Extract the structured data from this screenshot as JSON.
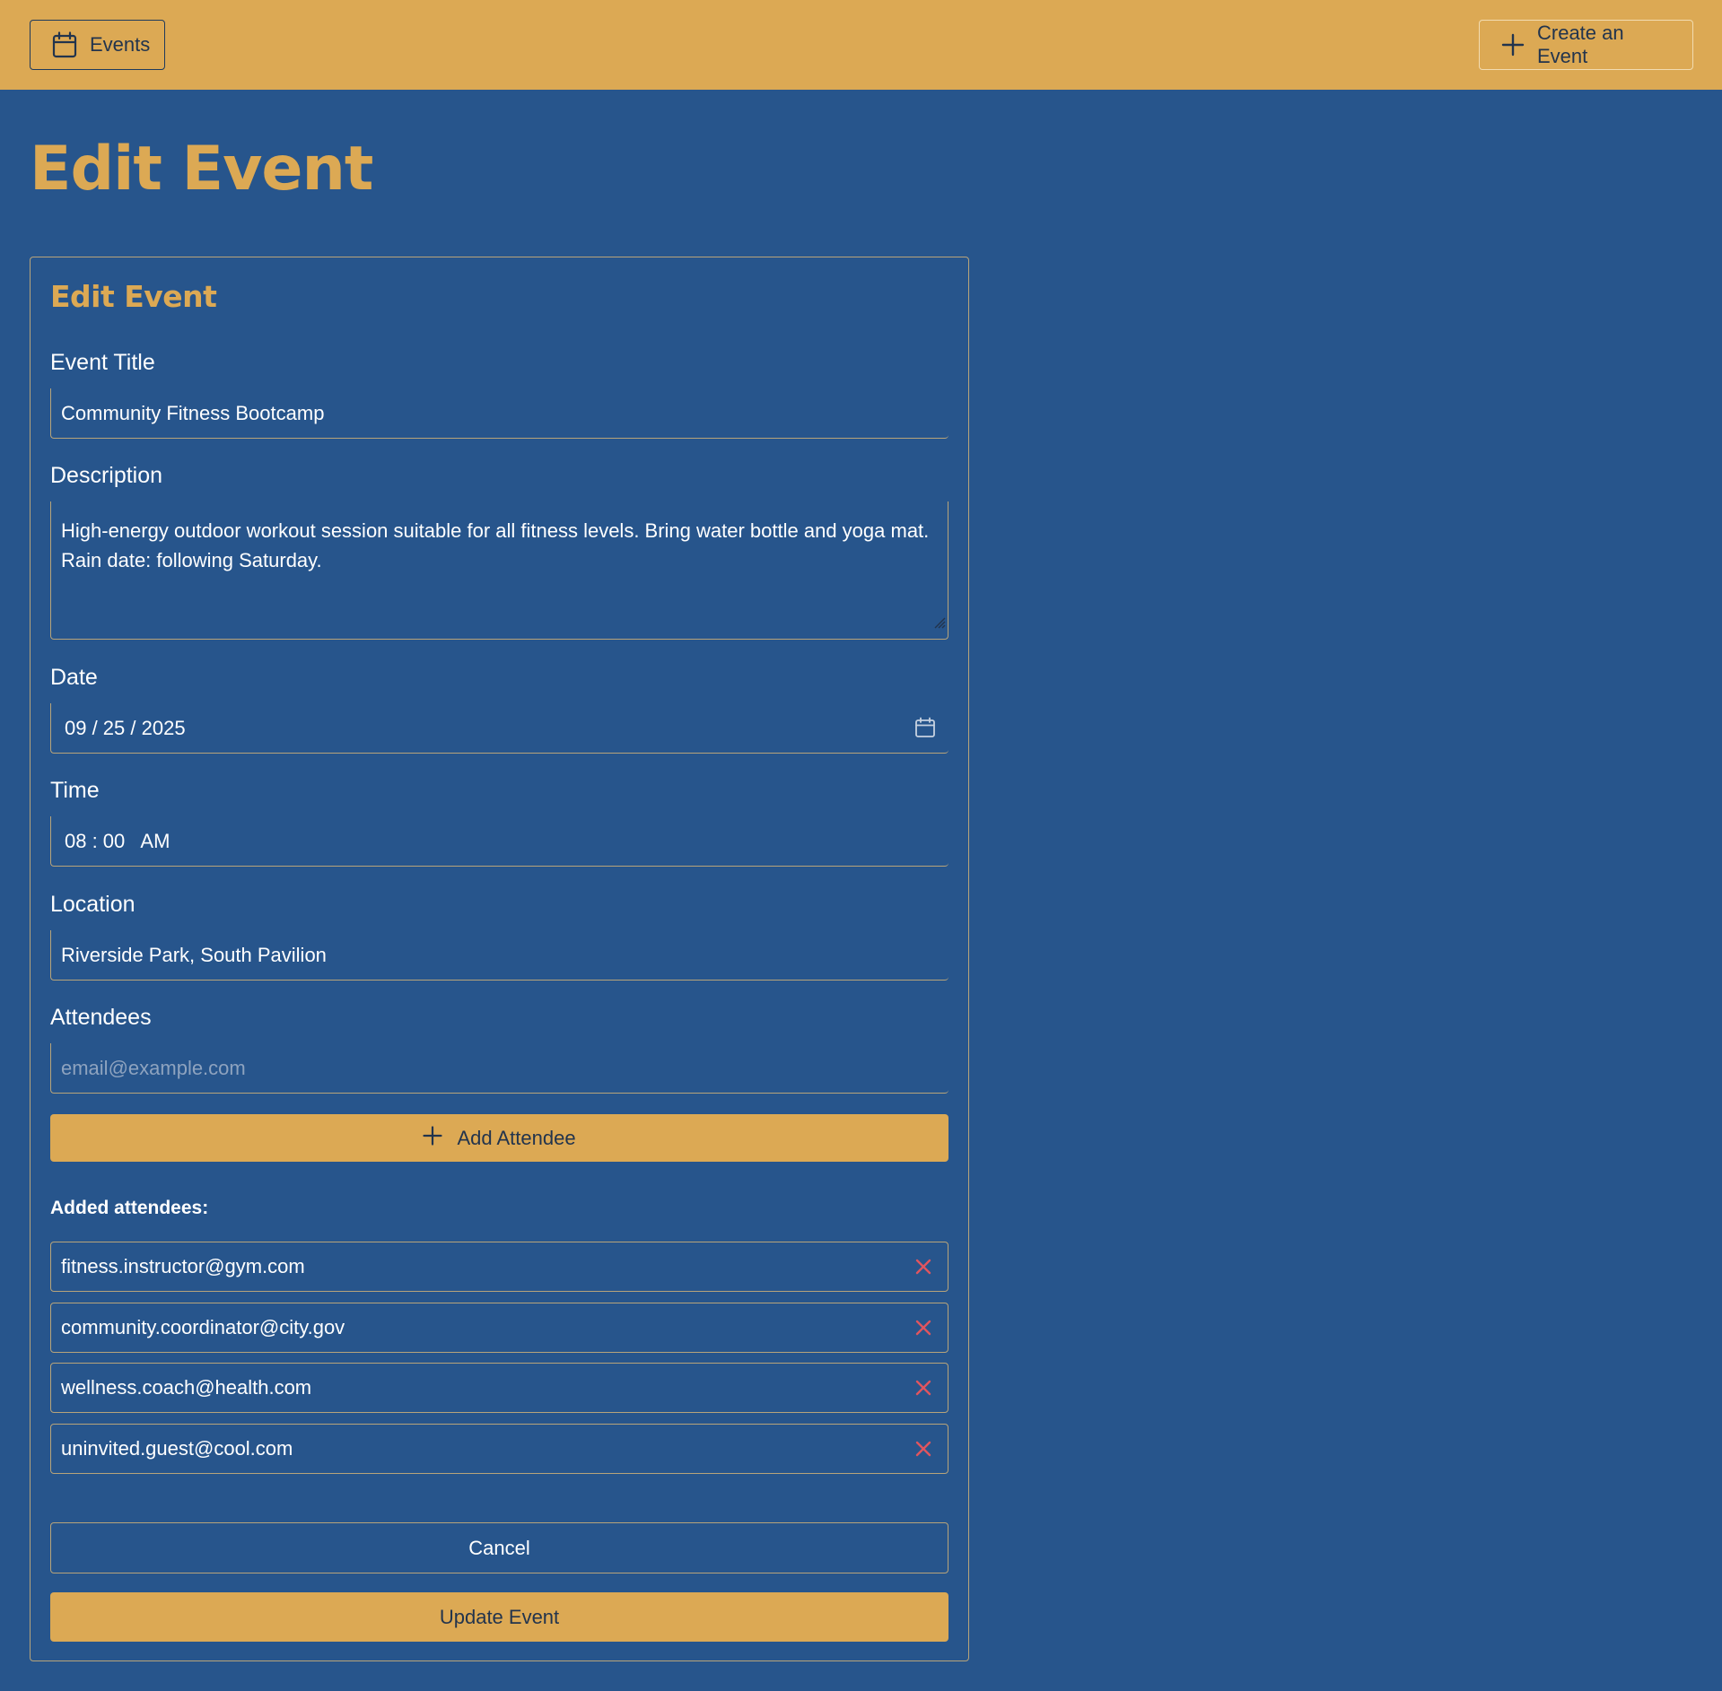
{
  "header": {
    "events_label": "Events",
    "events_icon": "calendar-icon",
    "create_label": "Create an Event",
    "create_icon": "plus-icon"
  },
  "page": {
    "title": "Edit Event"
  },
  "form": {
    "title": "Edit Event",
    "event_title": {
      "label": "Event Title",
      "value": "Community Fitness Bootcamp"
    },
    "description": {
      "label": "Description",
      "value_line1": "High-energy outdoor workout session suitable for all fitness levels. Bring water bottle and yoga mat.",
      "value_line2": "Rain date: following Saturday."
    },
    "date": {
      "label": "Date",
      "value": "09 / 25 / 2025",
      "icon": "calendar-icon"
    },
    "time": {
      "label": "Time",
      "value": "08 : 00   AM"
    },
    "location": {
      "label": "Location",
      "value": "Riverside Park, South Pavilion"
    },
    "attendees": {
      "label": "Attendees",
      "placeholder": "email@example.com",
      "add_label": "Add Attendee",
      "add_icon": "plus-icon",
      "added_label": "Added attendees:",
      "list": [
        "fitness.instructor@gym.com",
        "community.coordinator@city.gov",
        "wellness.coach@health.com",
        "uninvited.guest@cool.com"
      ],
      "remove_icon": "close-icon"
    },
    "cancel_label": "Cancel",
    "submit_label": "Update Event"
  },
  "colors": {
    "background": "#27558c",
    "accent": "#dca954",
    "dark_text": "#22344d",
    "remove": "#e0555f"
  }
}
